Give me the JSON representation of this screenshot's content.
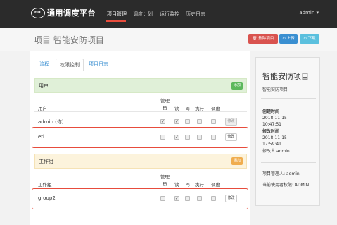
{
  "nav": {
    "logo_text": "ETL",
    "brand": "通用调度平台",
    "items": [
      "项目管理",
      "调度计划",
      "运行监控",
      "历史日志"
    ],
    "user": "admin ▾"
  },
  "header": {
    "title": "项目 智能安防项目",
    "delete_label": "🗑 删除项目",
    "upload_label": "⊙ 上传",
    "download_label": "⊙ 下载"
  },
  "tabs": [
    "流程",
    "权限控制",
    "项目日志"
  ],
  "users_panel": {
    "title": "用户",
    "add_label": "添加",
    "columns": [
      "用户",
      "管理",
      "员",
      "读",
      "写",
      "执行",
      "调度"
    ],
    "rows": [
      {
        "name": "admin (你)",
        "checks": [
          "✓",
          "✓",
          "",
          "",
          ""
        ],
        "edit_label": "修改"
      },
      {
        "name": "etl1",
        "checks": [
          "",
          "✓",
          "",
          "",
          ""
        ],
        "edit_label": "修改"
      }
    ]
  },
  "groups_panel": {
    "title": "工作组",
    "add_label": "添加",
    "columns": [
      "工作组",
      "管理",
      "员",
      "读",
      "写",
      "执行",
      "调度"
    ],
    "rows": [
      {
        "name": "group2",
        "checks": [
          "",
          "✓",
          "",
          "",
          ""
        ],
        "edit_label": "修改"
      }
    ]
  },
  "info_card": {
    "title": "智能安防项目",
    "subtitle": "智能安防项目",
    "created_label": "创建时间",
    "created_date": "2018-11-15",
    "created_time": "10:47:51",
    "modified_label": "修改时间",
    "modified_date": "2018-11-15",
    "modified_time": "17:59:41",
    "modifier": "修改人 admin",
    "manager": "项目管理人: admin",
    "current_permission": "当前使用者权限: ADMIN"
  },
  "colors": {
    "accent": "#e74c3c",
    "success": "#5cb85c",
    "warning": "#f0ad4e",
    "danger": "#d9534f",
    "primary": "#3a8fd1",
    "info": "#5bc0de"
  }
}
